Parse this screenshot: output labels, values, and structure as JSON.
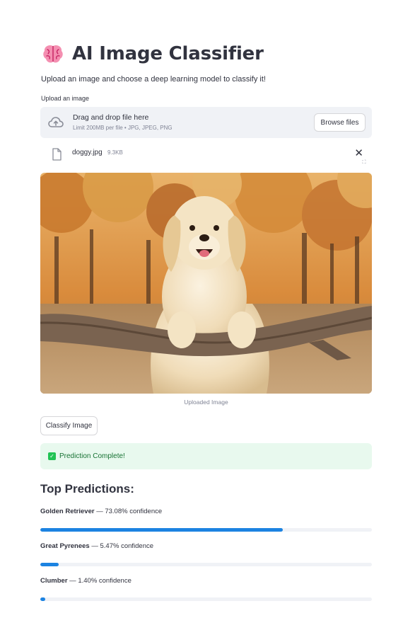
{
  "app": {
    "title": "AI Image Classifier",
    "title_icon": "brain-emoji",
    "subtitle": "Upload an image and choose a deep learning model to classify it!"
  },
  "uploader": {
    "label": "Upload an image",
    "drop_title": "Drag and drop file here",
    "drop_limit": "Limit 200MB per file • JPG, JPEG, PNG",
    "browse_label": "Browse files",
    "upload_icon": "cloud-upload-icon"
  },
  "file": {
    "name": "doggy.jpg",
    "size": "9.3KB",
    "remove_symbol": "✕"
  },
  "image": {
    "caption": "Uploaded Image",
    "subject": "golden retriever leaning on a log in an autumn field"
  },
  "actions": {
    "classify_label": "Classify Image"
  },
  "status": {
    "message": "Prediction Complete!",
    "color": "#21c354"
  },
  "predictions": {
    "title": "Top Predictions:",
    "items": [
      {
        "name": "Golden Retriever",
        "detail": " — 73.08% confidence",
        "confidence": 0.7308
      },
      {
        "name": "Great Pyrenees",
        "detail": " — 5.47% confidence",
        "confidence": 0.0547
      },
      {
        "name": "Clumber",
        "detail": " — 1.40% confidence",
        "confidence": 0.014
      }
    ],
    "bar_color": "#1c83e1"
  }
}
